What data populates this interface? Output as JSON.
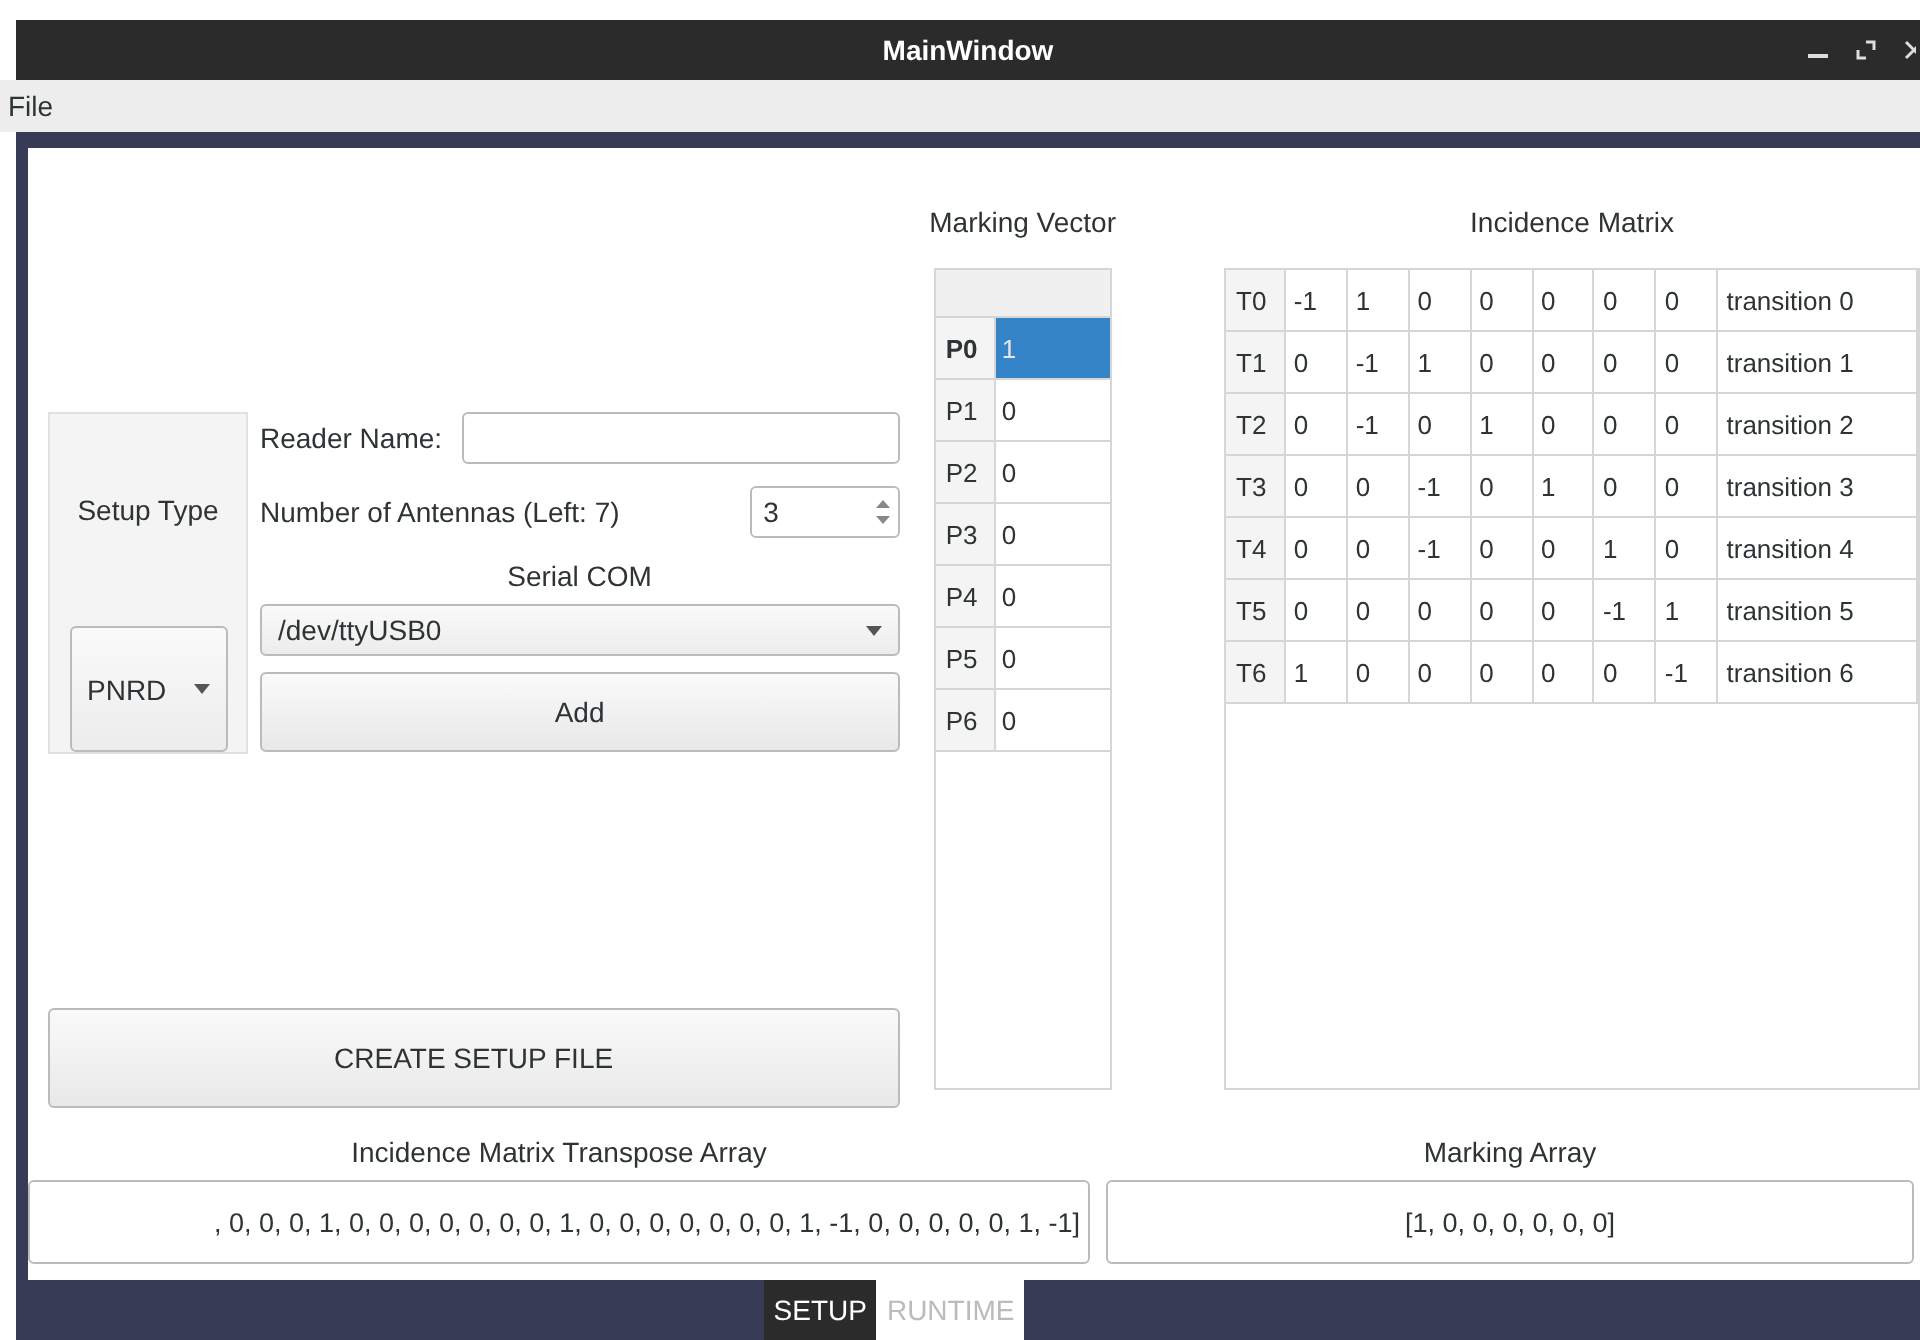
{
  "window": {
    "title": "MainWindow"
  },
  "menu": [
    "File"
  ],
  "setup": {
    "type_label": "Setup Type",
    "type_value": "PNRD",
    "reader_label": "Reader Name:",
    "antennas_label": "Number of Antennas  (Left: 7)",
    "antennas_value": "3",
    "serial_label": "Serial COM",
    "serial_value": "/dev/ttyUSB0",
    "add_button": "Add",
    "create_button": "CREATE SETUP FILE"
  },
  "marking_vector": {
    "title": "Marking Vector",
    "rows": [
      {
        "label": "P0",
        "value": "1",
        "selected": true
      },
      {
        "label": "P1",
        "value": "0",
        "selected": false
      },
      {
        "label": "P2",
        "value": "0",
        "selected": false
      },
      {
        "label": "P3",
        "value": "0",
        "selected": false
      },
      {
        "label": "P4",
        "value": "0",
        "selected": false
      },
      {
        "label": "P5",
        "value": "0",
        "selected": false
      },
      {
        "label": "P6",
        "value": "0",
        "selected": false
      }
    ]
  },
  "incidence_matrix": {
    "title": "Incidence Matrix",
    "rows": [
      {
        "label": "T0",
        "values": [
          "-1",
          "1",
          "0",
          "0",
          "0",
          "0",
          "0"
        ],
        "name": "transition 0"
      },
      {
        "label": "T1",
        "values": [
          "0",
          "-1",
          "1",
          "0",
          "0",
          "0",
          "0"
        ],
        "name": "transition 1"
      },
      {
        "label": "T2",
        "values": [
          "0",
          "-1",
          "0",
          "1",
          "0",
          "0",
          "0"
        ],
        "name": "transition 2"
      },
      {
        "label": "T3",
        "values": [
          "0",
          "0",
          "-1",
          "0",
          "1",
          "0",
          "0"
        ],
        "name": "transition 3"
      },
      {
        "label": "T4",
        "values": [
          "0",
          "0",
          "-1",
          "0",
          "0",
          "1",
          "0"
        ],
        "name": "transition 4"
      },
      {
        "label": "T5",
        "values": [
          "0",
          "0",
          "0",
          "0",
          "0",
          "-1",
          "1"
        ],
        "name": "transition 5"
      },
      {
        "label": "T6",
        "values": [
          "1",
          "0",
          "0",
          "0",
          "0",
          "0",
          "-1"
        ],
        "name": "transition 6"
      }
    ]
  },
  "transpose_array": {
    "label": "Incidence Matrix Transpose Array",
    "value": ", 0, 0, 0, 1, 0, 0, 0, 0, 0, 0, 0, 1, 0, 0, 0, 0, 0, 0, 0, 1, -1, 0, 0, 0, 0, 0, 1, -1]"
  },
  "marking_array": {
    "label": "Marking Array",
    "value": "[1, 0, 0, 0, 0, 0, 0]"
  },
  "tabs": [
    {
      "label": "SETUP",
      "selected": true
    },
    {
      "label": "RUNTIME",
      "selected": false
    }
  ]
}
